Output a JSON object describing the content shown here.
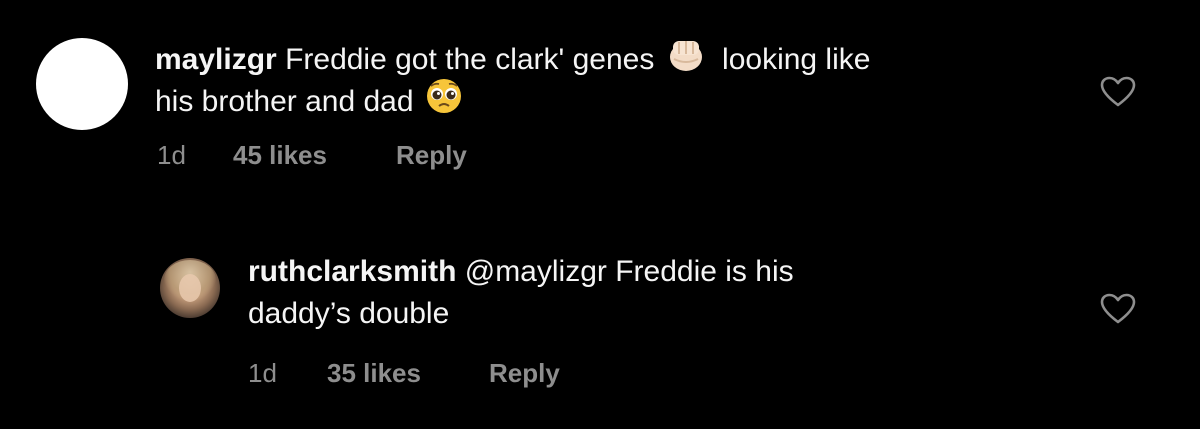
{
  "comments": [
    {
      "username": "maylizgr",
      "text_line1": "Freddie got the clark' genes",
      "emoji1": "fist-emoji",
      "text_line1b": "looking like",
      "text_line2": "his brother and dad",
      "emoji2": "pleading-face-emoji",
      "time": "1d",
      "likes": "45 likes",
      "reply": "Reply"
    },
    {
      "username": "ruthclarksmith",
      "text_line1": "@maylizgr Freddie is his",
      "text_line2": "daddy’s double",
      "time": "1d",
      "likes": "35 likes",
      "reply": "Reply"
    }
  ],
  "colors": {
    "background": "#000000",
    "text": "#f5f5f5",
    "meta": "#8e8e8e",
    "heart": "#8e8e8e"
  }
}
